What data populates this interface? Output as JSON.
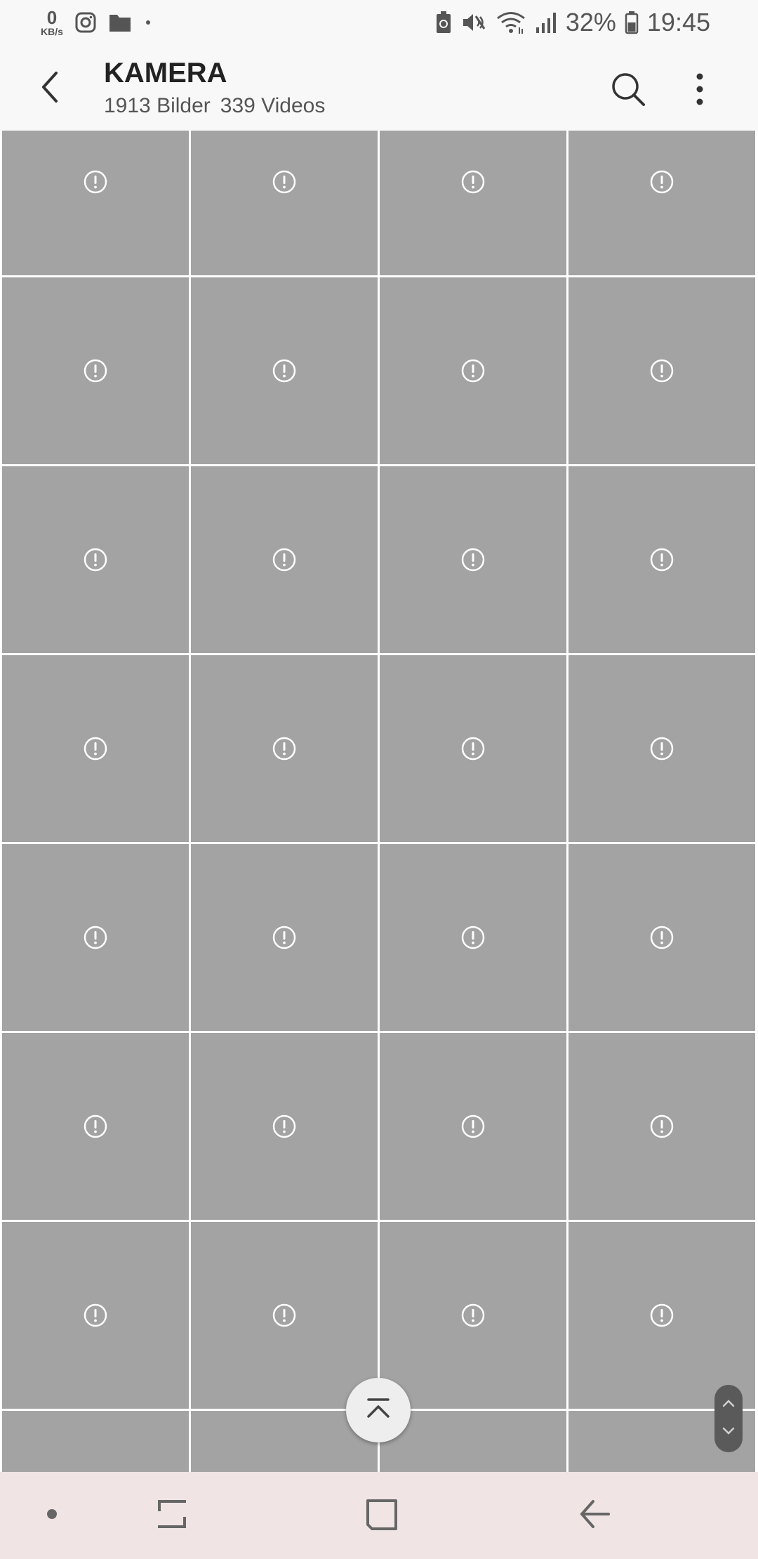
{
  "status_bar": {
    "net_speed_value": "0",
    "net_speed_unit": "KB/s",
    "battery_percent": "32%",
    "time": "19:45",
    "icons": [
      "instagram-icon",
      "folder-icon",
      "dot-icon",
      "battery-saver-icon",
      "mute-icon",
      "wifi-icon",
      "signal-icon",
      "battery-icon"
    ]
  },
  "app_bar": {
    "title": "KAMERA",
    "image_count": "1913 Bilder",
    "video_count": "339 Videos",
    "icons": [
      "back-arrow-icon",
      "search-icon",
      "more-vert-icon"
    ]
  },
  "grid": {
    "columns": 4,
    "tile_icon": "error-icon",
    "tile_color": "#a3a3a3"
  },
  "floating": {
    "scroll_to_top_icon": "chevron-up-bar-icon",
    "fast_scroller_icons": [
      "chevron-up-icon",
      "chevron-down-icon"
    ]
  },
  "nav_bar": {
    "icons": [
      "dot-icon",
      "recents-icon",
      "home-icon",
      "back-icon"
    ],
    "background": "#f1e4e4"
  }
}
